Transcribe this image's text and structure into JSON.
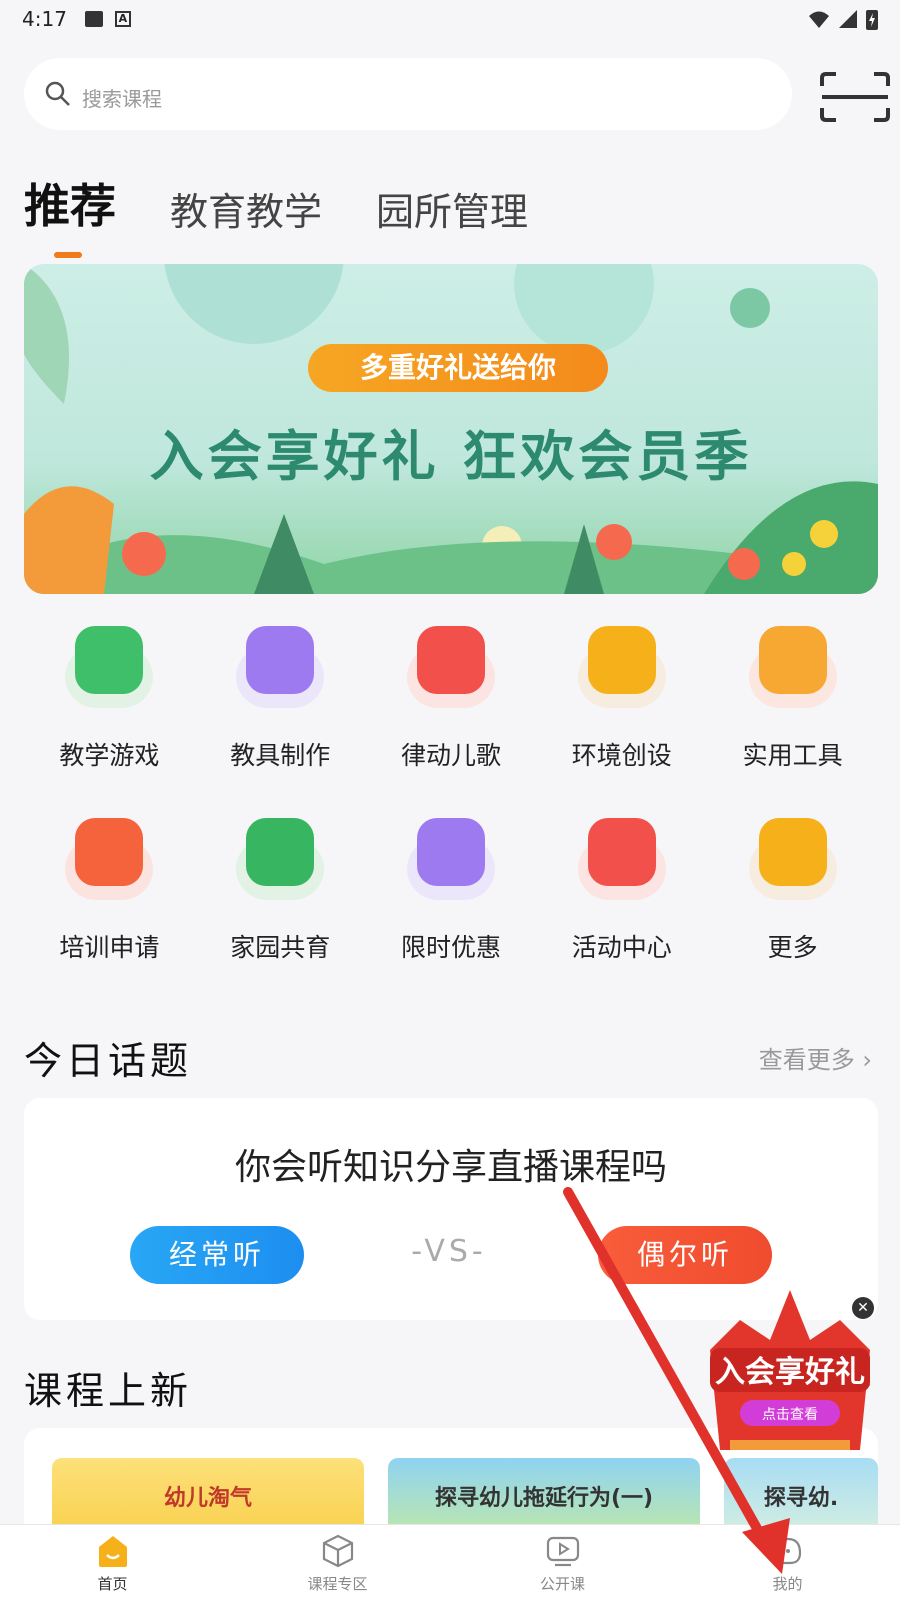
{
  "status_bar": {
    "time": "4:17"
  },
  "search": {
    "placeholder": "搜索课程"
  },
  "tabs": [
    {
      "label": "推荐",
      "active": true
    },
    {
      "label": "教育教学",
      "active": false
    },
    {
      "label": "园所管理",
      "active": false
    }
  ],
  "banner": {
    "pill_text": "多重好礼送给你",
    "headline": "入会享好礼 狂欢会员季"
  },
  "grid": [
    {
      "label": "教学游戏",
      "icon": "leaf-game-icon",
      "fg": "#3fbf69",
      "bg": "#e2f3e6"
    },
    {
      "label": "教具制作",
      "icon": "scissors-icon",
      "fg": "#9d7af0",
      "bg": "#ece6fb"
    },
    {
      "label": "律动儿歌",
      "icon": "radio-icon",
      "fg": "#f2504a",
      "bg": "#fbe4e2"
    },
    {
      "label": "环境创设",
      "icon": "lightbulb-icon",
      "fg": "#f6b01a",
      "bg": "#f6ece0"
    },
    {
      "label": "实用工具",
      "icon": "ruler-pencil-icon",
      "fg": "#f6a833",
      "bg": "#fbe6e0"
    },
    {
      "label": "培训申请",
      "icon": "training-board-icon",
      "fg": "#f4633c",
      "bg": "#fbe4e0"
    },
    {
      "label": "家园共育",
      "icon": "house-icon",
      "fg": "#37b561",
      "bg": "#e2f3e6"
    },
    {
      "label": "限时优惠",
      "icon": "alarm-clock-icon",
      "fg": "#9d7af0",
      "bg": "#ece6fb"
    },
    {
      "label": "活动中心",
      "icon": "gift-icon",
      "fg": "#f2504a",
      "bg": "#fbe4e2"
    },
    {
      "label": "更多",
      "icon": "more-blocks-icon",
      "fg": "#f6b01a",
      "bg": "#f6ece0"
    }
  ],
  "topic": {
    "title": "今日话题",
    "more": "查看更多",
    "question": "你会听知识分享直播课程吗",
    "option_a": "经常听",
    "vs": "-VS-",
    "option_b": "偶尔听"
  },
  "courses": {
    "title": "课程上新",
    "items": [
      {
        "title": "幼儿淘气"
      },
      {
        "title": "探寻幼儿拖延行为(一)"
      },
      {
        "title": "探寻幼."
      }
    ]
  },
  "vip_float": {
    "text": "入会享好礼",
    "sub": "点击查看"
  },
  "bottom_nav": [
    {
      "label": "首页",
      "icon": "home-icon",
      "active": true
    },
    {
      "label": "课程专区",
      "icon": "cube-icon",
      "active": false
    },
    {
      "label": "公开课",
      "icon": "play-icon",
      "active": false
    },
    {
      "label": "我的",
      "icon": "profile-icon",
      "active": false
    }
  ],
  "colors": {
    "accent": "#f07a1c",
    "blue": "#1d8ef0",
    "red": "#f04b2e"
  }
}
